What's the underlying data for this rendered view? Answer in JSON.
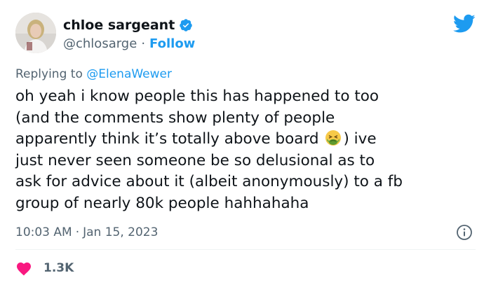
{
  "author": {
    "display_name": "chloe sargeant",
    "handle": "@chlosarge",
    "separator": "·",
    "follow_label": "Follow",
    "verified_icon": "verified-badge-icon",
    "avatar_icon": "profile-photo"
  },
  "reply": {
    "prefix": "Replying to",
    "mention": "@ElenaWewer"
  },
  "tweet": {
    "lines": [
      "oh yeah i know people this has happened to too",
      "(and the comments show plenty of people",
      "apparently think it’s totally above board",
      ") ive",
      "just never seen someone be so delusional as to",
      "ask for advice about it (albeit anonymously) to a fb",
      "group of nearly 80k people hahhahaha"
    ],
    "emoji": "nauseated-face-icon"
  },
  "meta": {
    "time": "10:03 AM",
    "separator": "·",
    "date": "Jan 15, 2023"
  },
  "engagement": {
    "likes": "1.3K"
  },
  "colors": {
    "accent": "#1d9bf0",
    "text": "#0f1419",
    "secondary": "#536471",
    "like": "#f91880",
    "divider": "#eff3f4"
  }
}
